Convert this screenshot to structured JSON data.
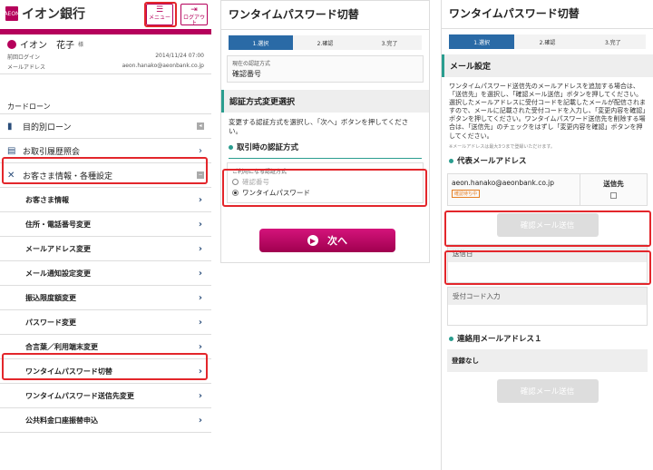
{
  "panel1": {
    "logo_mark": "AEON",
    "logo_text": "イオン銀行",
    "menu_label": "メニュー",
    "menu_icon": "menu-icon",
    "logout_label": "ログアウト",
    "logout_icon": "logout-icon",
    "user_name": "イオン　花子",
    "user_suffix": "様",
    "last_login_label": "前回ログイン",
    "last_login_value": "2014/11/24 07:00",
    "email_label": "メールアドレス",
    "email_value": "aeon.hanako@aeonbank.co.jp",
    "cut_item": "カードローン",
    "nav": [
      {
        "label": "目的別ローン",
        "icon": "card-icon",
        "tail": "square"
      },
      {
        "label": "お取引履歴照会",
        "icon": "document-icon",
        "tail": "chevron"
      },
      {
        "label": "お客さま情報・各種設定",
        "icon": "tools-icon",
        "tail": "minus"
      }
    ],
    "sub": [
      "お客さま情報",
      "住所・電話番号変更",
      "メールアドレス変更",
      "メール通知設定変更",
      "振込限度額変更",
      "パスワード変更",
      "合言葉／利用端末変更",
      "ワンタイムパスワード切替",
      "ワンタイムパスワード送信先変更",
      "公共料金口座振替申込"
    ]
  },
  "panel2": {
    "title": "ワンタイムパスワード切替",
    "steps": [
      "1.選択",
      "2.確認",
      "3.完了"
    ],
    "current_label": "現在の認証方式",
    "current_value": "確認番号",
    "section": "認証方式変更選択",
    "desc": "変更する認証方式を選択し、「次へ」ボタンを押してください。",
    "subhead": "取引時の認証方式",
    "radio_group_label": "ご利用になる認証方式",
    "radio_options": [
      "確認番号",
      "ワンタイムパスワード"
    ],
    "next_label": "次へ"
  },
  "panel3": {
    "title": "ワンタイムパスワード切替",
    "steps": [
      "1.選択",
      "2.確認",
      "3.完了"
    ],
    "section": "メール設定",
    "desc": "ワンタイムパスワード送信先のメールアドレスを追加する場合は、「送信先」を選択し、「確認メール送信」ボタンを押してください。選択したメールアドレスに受付コードを記載したメールが配信されますので、メールに記載された受付コードを入力し、「変更内容を確認」ボタンを押してください。ワンタイムパスワード送信先を削除する場合は、「送信先」のチェックをはずし「変更内容を確認」ボタンを押してください。",
    "note": "※メールアドレスは最大3つまで登録いただけます。",
    "rep_heading": "代表メールアドレス",
    "email": "aeon.hanako@aeonbank.co.jp",
    "badge": "確認待ち中",
    "send_to": "送信先",
    "confirm_btn": "確認メール送信",
    "sent_date_label": "送信日",
    "code_label": "受付コード入力",
    "contact_heading": "連絡用メールアドレス１",
    "none": "登録なし",
    "confirm_btn2": "確認メール送信"
  }
}
